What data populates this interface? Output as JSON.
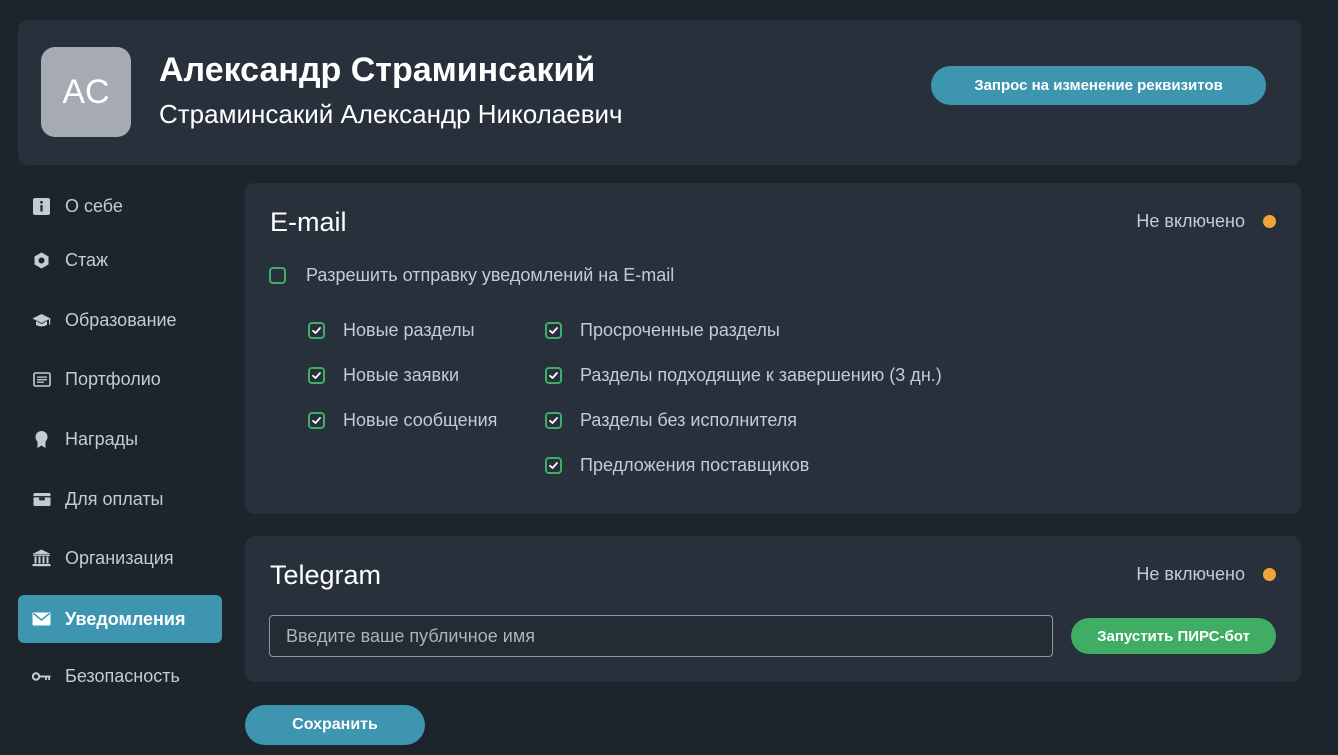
{
  "profile": {
    "avatar_initials": "AC",
    "name": "Александр Страминсакий",
    "full_name": "Страминсакий Александр Николаевич",
    "request_button": "Запрос на изменение реквизитов"
  },
  "sidebar": {
    "items": [
      {
        "label": "О себе",
        "icon": "info-icon"
      },
      {
        "label": "Стаж",
        "icon": "hexagon-icon"
      },
      {
        "label": "Образование",
        "icon": "graduation-cap-icon"
      },
      {
        "label": "Портфолио",
        "icon": "document-icon"
      },
      {
        "label": "Награды",
        "icon": "award-icon"
      },
      {
        "label": "Для оплаты",
        "icon": "wallet-icon"
      },
      {
        "label": "Организация",
        "icon": "bank-icon"
      },
      {
        "label": "Уведомления",
        "icon": "envelope-icon",
        "active": true
      },
      {
        "label": "Безопасность",
        "icon": "key-icon"
      }
    ]
  },
  "email": {
    "title": "E-mail",
    "status": "Не включено",
    "allow_label": "Разрешить отправку уведомлений на E-mail",
    "allow_checked": false,
    "left_options": [
      {
        "label": "Новые разделы",
        "checked": true
      },
      {
        "label": "Новые заявки",
        "checked": true
      },
      {
        "label": "Новые сообщения",
        "checked": true
      }
    ],
    "right_options": [
      {
        "label": "Просроченные разделы",
        "checked": true
      },
      {
        "label": "Разделы подходящие к завершению (3 дн.)",
        "checked": true
      },
      {
        "label": "Разделы без исполнителя",
        "checked": true
      },
      {
        "label": "Предложения поставщиков",
        "checked": true
      }
    ]
  },
  "telegram": {
    "title": "Telegram",
    "status": "Не включено",
    "input_placeholder": "Введите ваше публичное имя",
    "input_value": "",
    "bot_button": "Запустить ПИРС-бот"
  },
  "save_button": "Сохранить",
  "colors": {
    "background": "#1d252c",
    "card": "#28313b",
    "accent": "#3e95b0",
    "success": "#3fae64",
    "status_dot": "#f0a43a"
  }
}
